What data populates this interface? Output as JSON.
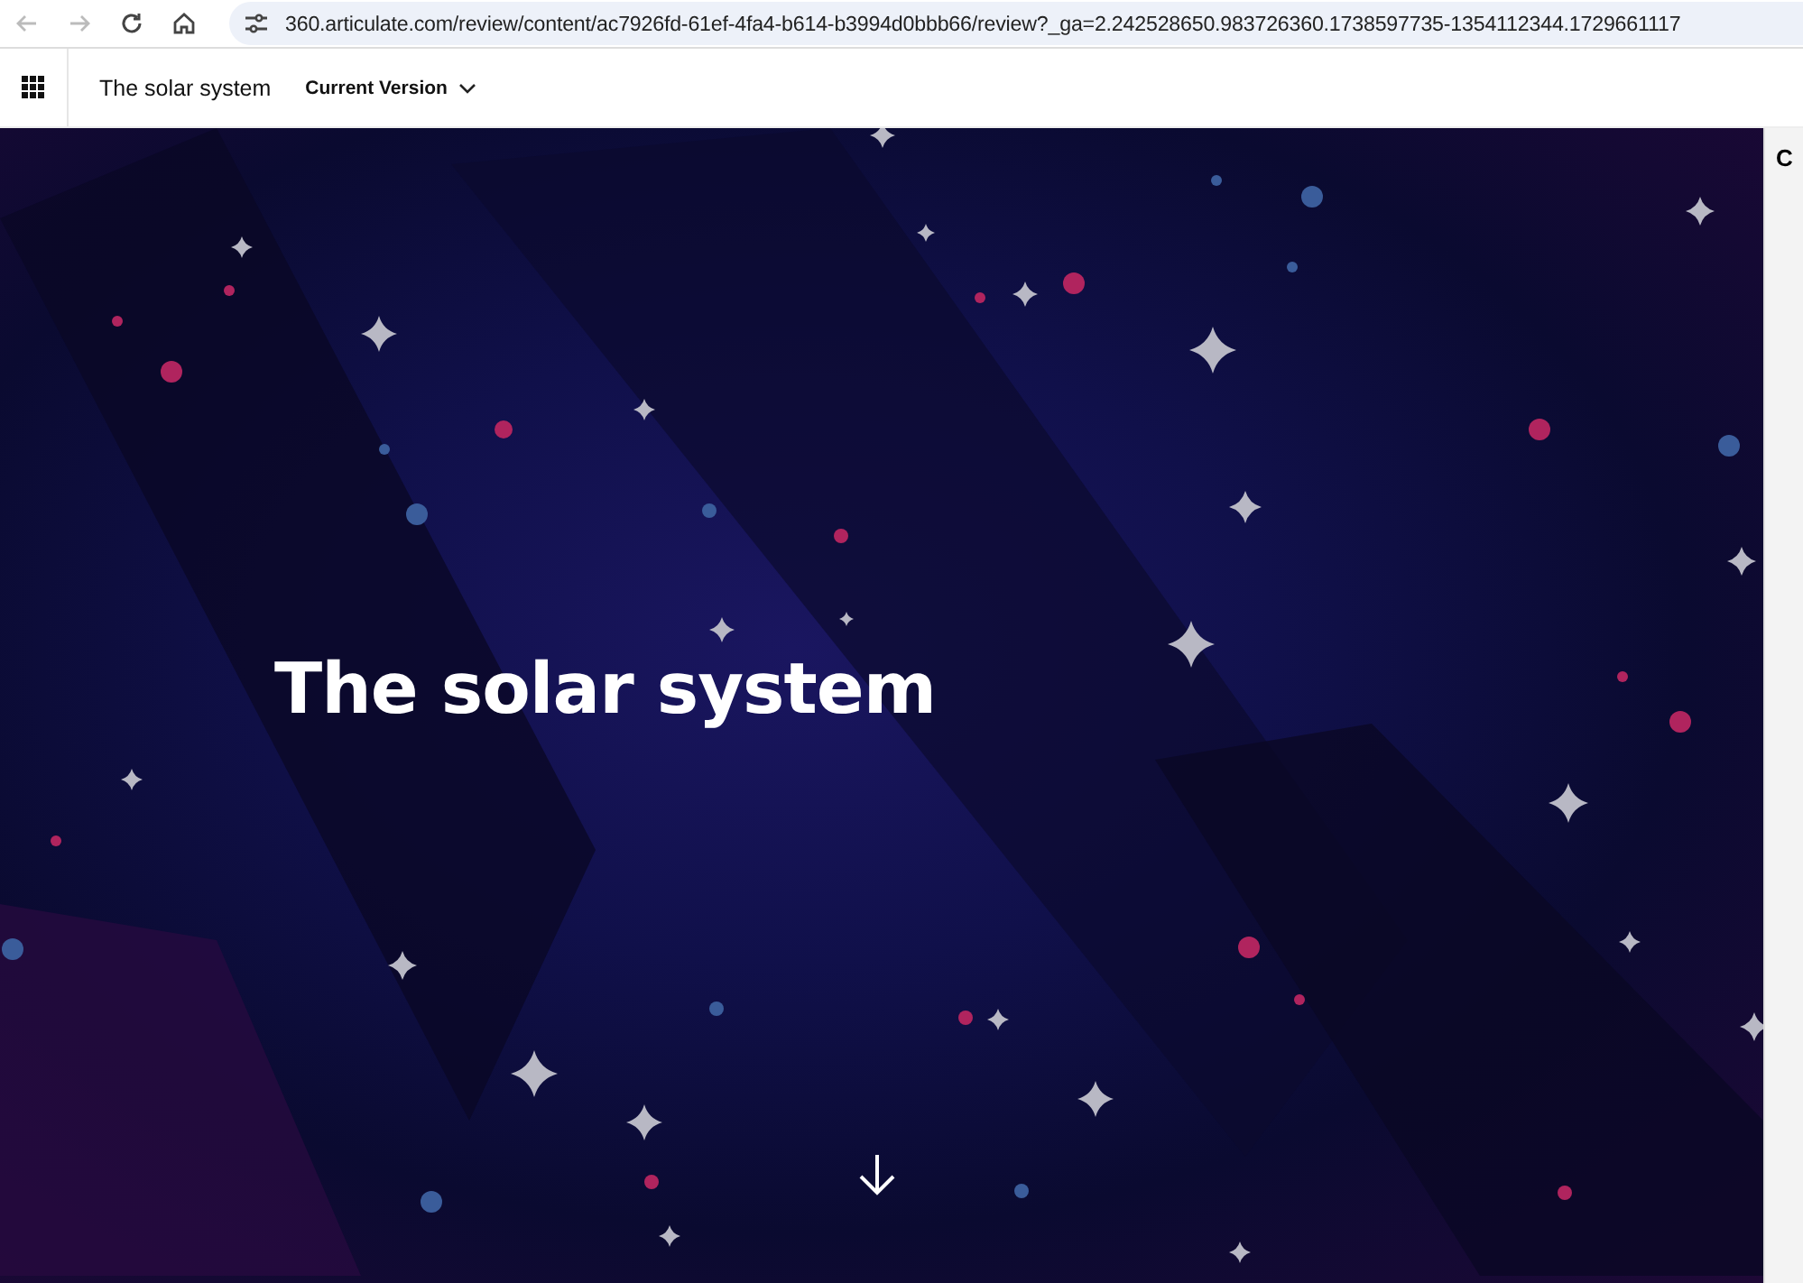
{
  "browser": {
    "url": "360.articulate.com/review/content/ac7926fd-61ef-4fa4-b614-b3994d0bbb66/review?_ga=2.242528650.983726360.1738597735-1354112344.1729661117"
  },
  "header": {
    "course_title": "The solar system",
    "version_menu": "Current Version"
  },
  "slide": {
    "title": "The solar system"
  },
  "side_panel": {
    "heading": "C"
  }
}
